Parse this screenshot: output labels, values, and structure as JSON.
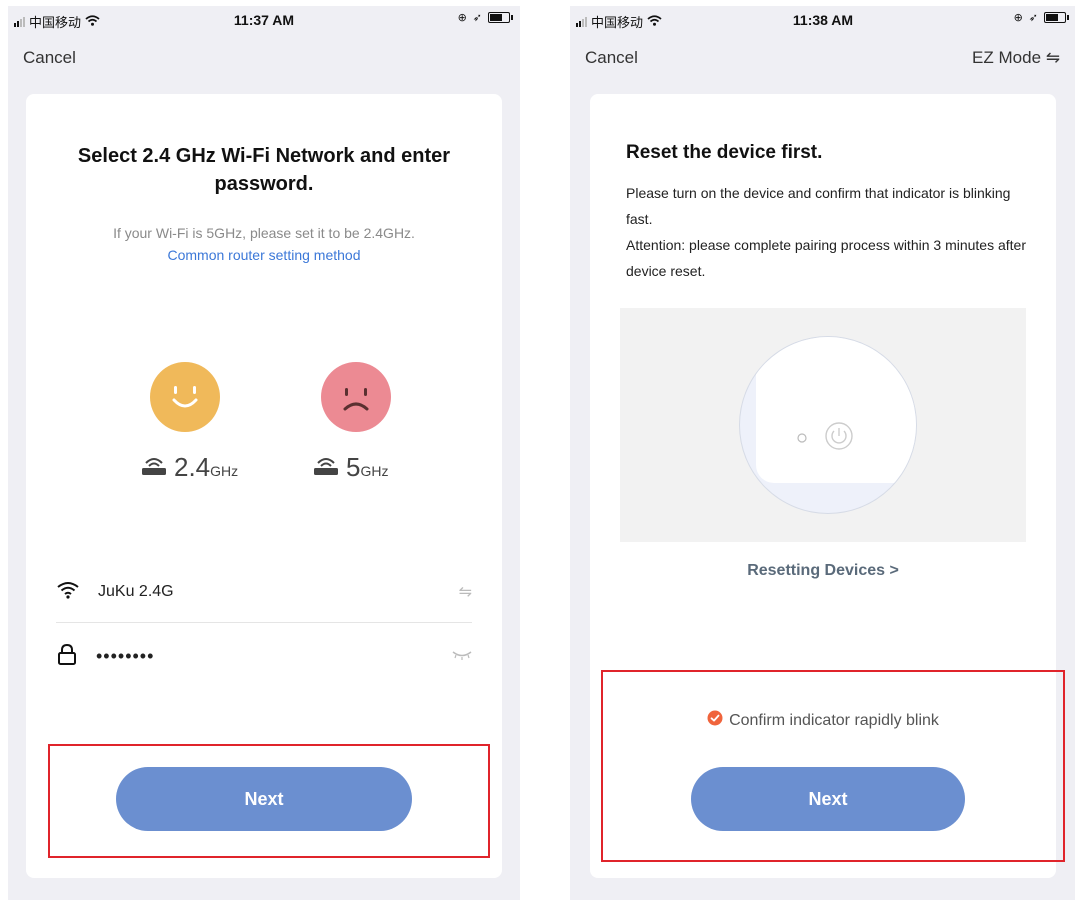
{
  "left": {
    "status": {
      "carrier": "中国移动",
      "time": "11:37 AM"
    },
    "cancel_label": "Cancel",
    "title": "Select 2.4 GHz Wi-Fi Network and enter password.",
    "hint": "If your Wi-Fi is 5GHz, please set it to be 2.4GHz.",
    "router_link": "Common router setting method",
    "band_24": {
      "num": "2.4",
      "unit": "GHz"
    },
    "band_5": {
      "num": "5",
      "unit": "GHz"
    },
    "wifi_name": "JuKu 2.4G",
    "password": "••••••••",
    "next_label": "Next"
  },
  "right": {
    "status": {
      "carrier": "中国移动",
      "time": "11:38 AM"
    },
    "cancel_label": "Cancel",
    "ez_mode_label": "EZ Mode ⇋",
    "title": "Reset the device first.",
    "body_line1": "Please turn on the device and confirm that indicator is blinking fast.",
    "body_line2": "Attention: please complete pairing process within 3 minutes after device reset.",
    "reset_link": "Resetting Devices >",
    "confirm_label": "Confirm indicator rapidly blink",
    "next_label": "Next"
  },
  "colors": {
    "accent": "#6b8fd0",
    "link": "#3c78d8",
    "highlight": "#e0242b",
    "check": "#f0643c",
    "happy": "#f0b95a",
    "sad": "#ec8a93"
  }
}
